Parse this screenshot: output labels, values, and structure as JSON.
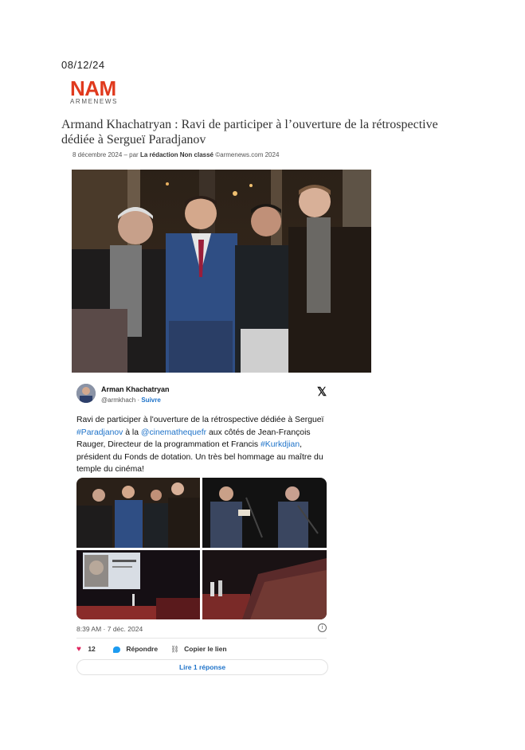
{
  "page": {
    "date": "08/12/24"
  },
  "logo": {
    "name": "NAM",
    "subtitle": "ARMENEWS"
  },
  "article": {
    "title": "Armand Khachatryan : Ravi de participer à l’ouverture de la rétrospective dédiée à Sergueï Paradjanov",
    "date": "8 décembre 2024",
    "by": " – par ",
    "author": "La rédaction",
    "category": "Non classé",
    "copyright": "©armenews.com 2024"
  },
  "tweet": {
    "author_name": "Arman Khachatryan",
    "handle": "@armkhach",
    "separator": " · ",
    "follow_label": "Suivre",
    "x_icon": "x-logo-icon",
    "text": {
      "t1": "Ravi de participer à l'ouverture de la rétrospective dédiée à Sergueï ",
      "l1": "#Paradjanov",
      "t2": " à la ",
      "l2": "@cinemathequefr",
      "t3": " aux côtés de Jean-François Rauger, Directeur de la programmation et Francis ",
      "l3": "#Kurkdjian",
      "t4": ", président du Fonds de dotation. Un très bel hommage au maître du temple du cinéma!"
    },
    "timestamp": "8:39 AM · 7 déc. 2024",
    "likes": "12",
    "reply_label": "Répondre",
    "copy_link_label": "Copier le lien",
    "read_replies_label": "Lire 1 réponse",
    "colors": {
      "link": "#1d72c9",
      "heart": "#f91880",
      "brand": "#e03a1e"
    }
  }
}
